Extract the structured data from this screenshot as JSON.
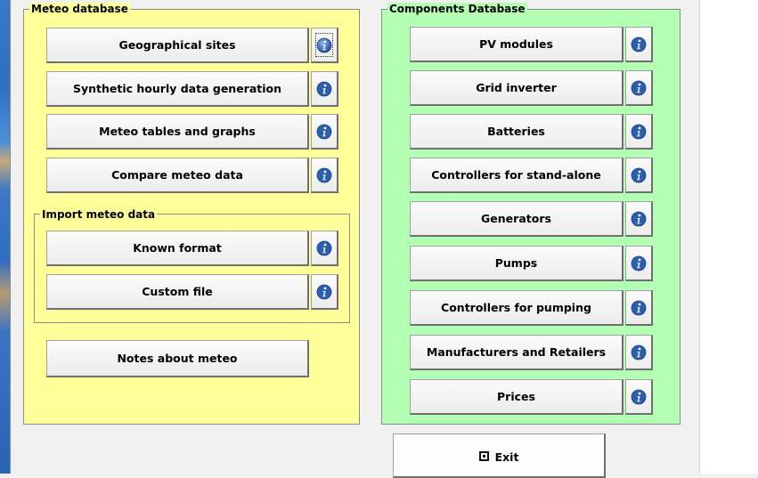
{
  "meteo": {
    "title": "Meteo database",
    "buttons": [
      {
        "label": "Geographical sites"
      },
      {
        "label": "Synthetic hourly data generation"
      },
      {
        "label": "Meteo tables and graphs"
      },
      {
        "label": "Compare meteo data"
      }
    ],
    "import": {
      "title": "Import meteo data",
      "buttons": [
        {
          "label": "Known format"
        },
        {
          "label": "Custom file"
        }
      ]
    },
    "notes_label": "Notes about meteo"
  },
  "components": {
    "title": "Components Database",
    "buttons": [
      {
        "label": "PV modules"
      },
      {
        "label": "Grid inverter"
      },
      {
        "label": "Batteries"
      },
      {
        "label": "Controllers for stand-alone"
      },
      {
        "label": "Generators"
      },
      {
        "label": "Pumps"
      },
      {
        "label": "Controllers for pumping"
      },
      {
        "label": "Manufacturers and Retailers"
      },
      {
        "label": "Prices"
      }
    ]
  },
  "exit_label": "Exit",
  "colors": {
    "meteo_bg": "#ffff99",
    "components_bg": "#b3ffb3",
    "info_icon": "#2a5fb0"
  },
  "icons": {
    "info": "info-icon",
    "exit": "exit-checkbox-icon"
  }
}
